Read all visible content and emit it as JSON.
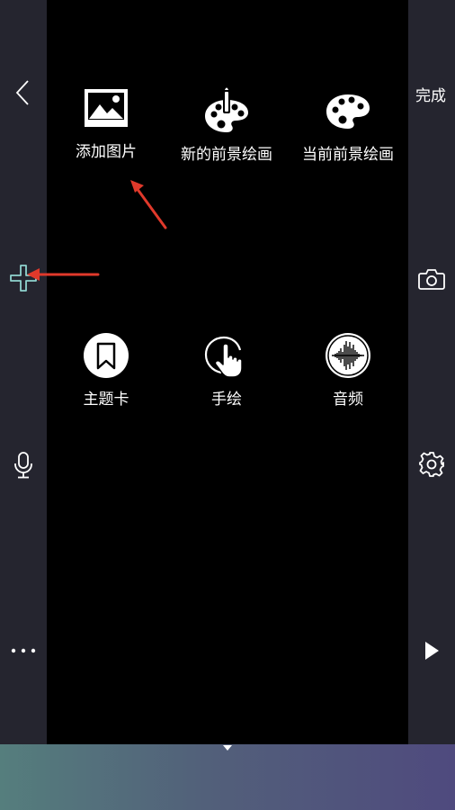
{
  "left_bar": {
    "items": [
      {
        "icon": "chevron-left-icon"
      },
      {
        "icon": "plus-icon",
        "color": "#8fd4cf"
      },
      {
        "icon": "microphone-icon"
      },
      {
        "icon": "more-icon"
      }
    ]
  },
  "right_bar": {
    "done_label": "完成",
    "items": [
      {
        "icon": "camera-icon"
      },
      {
        "icon": "gear-icon"
      },
      {
        "icon": "play-icon"
      }
    ]
  },
  "menu": {
    "tiles": [
      {
        "label": "添加图片",
        "icon": "image-icon"
      },
      {
        "label": "新的前景绘画",
        "icon": "palette-brush-icon"
      },
      {
        "label": "当前前景绘画",
        "icon": "palette-icon"
      },
      {
        "label": "主题卡",
        "icon": "bookmark-icon"
      },
      {
        "label": "手绘",
        "icon": "hand-pointer-icon"
      },
      {
        "label": "音频",
        "icon": "waveform-icon"
      }
    ]
  },
  "annotation_color": "#e0392b"
}
